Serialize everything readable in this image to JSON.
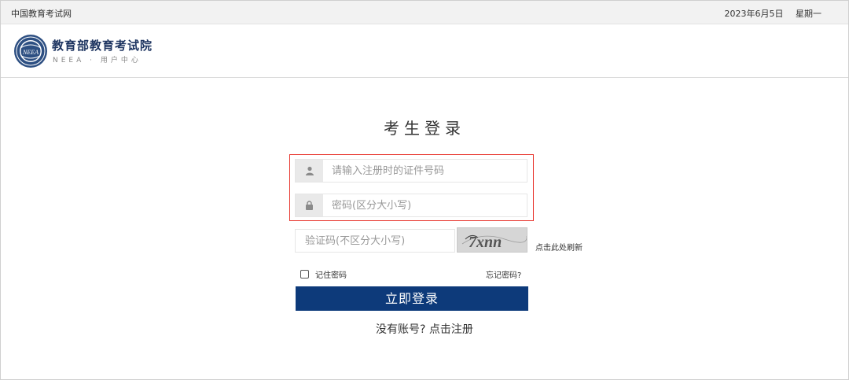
{
  "topbar": {
    "site_name": "中国教育考试网",
    "date": "2023年6月5日",
    "weekday": "星期一"
  },
  "header": {
    "org_name": "教育部教育考试院",
    "subtitle": "NEEA · 用户中心",
    "emblem_text": "NEEA"
  },
  "login": {
    "title": "考生登录",
    "id_placeholder": "请输入注册时的证件号码",
    "password_placeholder": "密码(区分大小写)",
    "captcha_placeholder": "验证码(不区分大小写)",
    "captcha_text": "7xnn",
    "refresh_label": "点击此处刷新",
    "remember_label": "记住密码",
    "forgot_label": "忘记密码?",
    "submit_label": "立即登录",
    "register_label": "没有账号? 点击注册"
  },
  "colors": {
    "primary_button": "#0d3a7a",
    "highlight_border": "#e8362f",
    "brand_text": "#1e3561"
  },
  "icons": [
    "user-icon",
    "lock-icon",
    "neea-emblem-icon"
  ]
}
